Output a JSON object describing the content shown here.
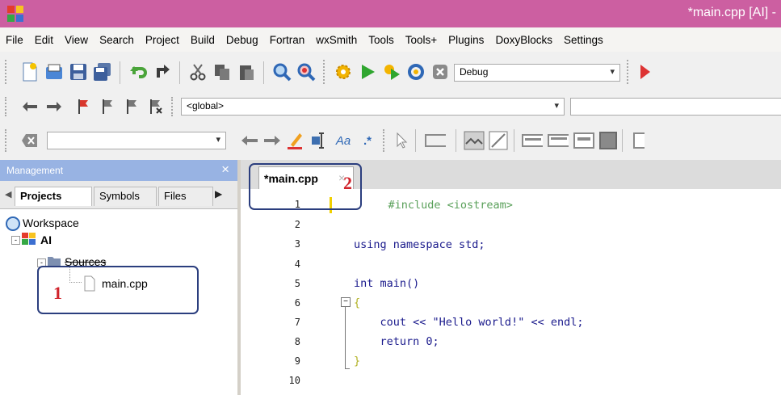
{
  "window": {
    "title": "*main.cpp [AI] -"
  },
  "menu": [
    "File",
    "Edit",
    "View",
    "Search",
    "Project",
    "Build",
    "Debug",
    "Fortran",
    "wxSmith",
    "Tools",
    "Tools+",
    "Plugins",
    "DoxyBlocks",
    "Settings"
  ],
  "toolbar": {
    "build_target": "Debug",
    "scope": "<global>",
    "search_value": ""
  },
  "management": {
    "title": "Management",
    "close": "×",
    "tabs": [
      "Projects",
      "Symbols",
      "Files"
    ],
    "tree": {
      "workspace": "Workspace",
      "project": "AI",
      "folder": "Sources",
      "file": "main.cpp"
    }
  },
  "editor": {
    "tab_label": "*main.cpp",
    "tab_close": "×",
    "lines": [
      {
        "num": "1",
        "text": "    #include <iostream>"
      },
      {
        "num": "2",
        "text": ""
      },
      {
        "num": "3",
        "text": "using namespace std;"
      },
      {
        "num": "4",
        "text": ""
      },
      {
        "num": "5",
        "text": "int main()"
      },
      {
        "num": "6",
        "text": "{"
      },
      {
        "num": "7",
        "text": "    cout << \"Hello world!\" << endl;"
      },
      {
        "num": "8",
        "text": "    return 0;"
      },
      {
        "num": "9",
        "text": "}"
      },
      {
        "num": "10",
        "text": ""
      }
    ]
  },
  "annotations": {
    "one": "1",
    "two": "2"
  },
  "colors": {
    "titlebar": "#cc5fa1",
    "panel_header": "#98b3e3",
    "annotation_box": "#2b3e7e",
    "annotation_number": "#d0232b"
  }
}
